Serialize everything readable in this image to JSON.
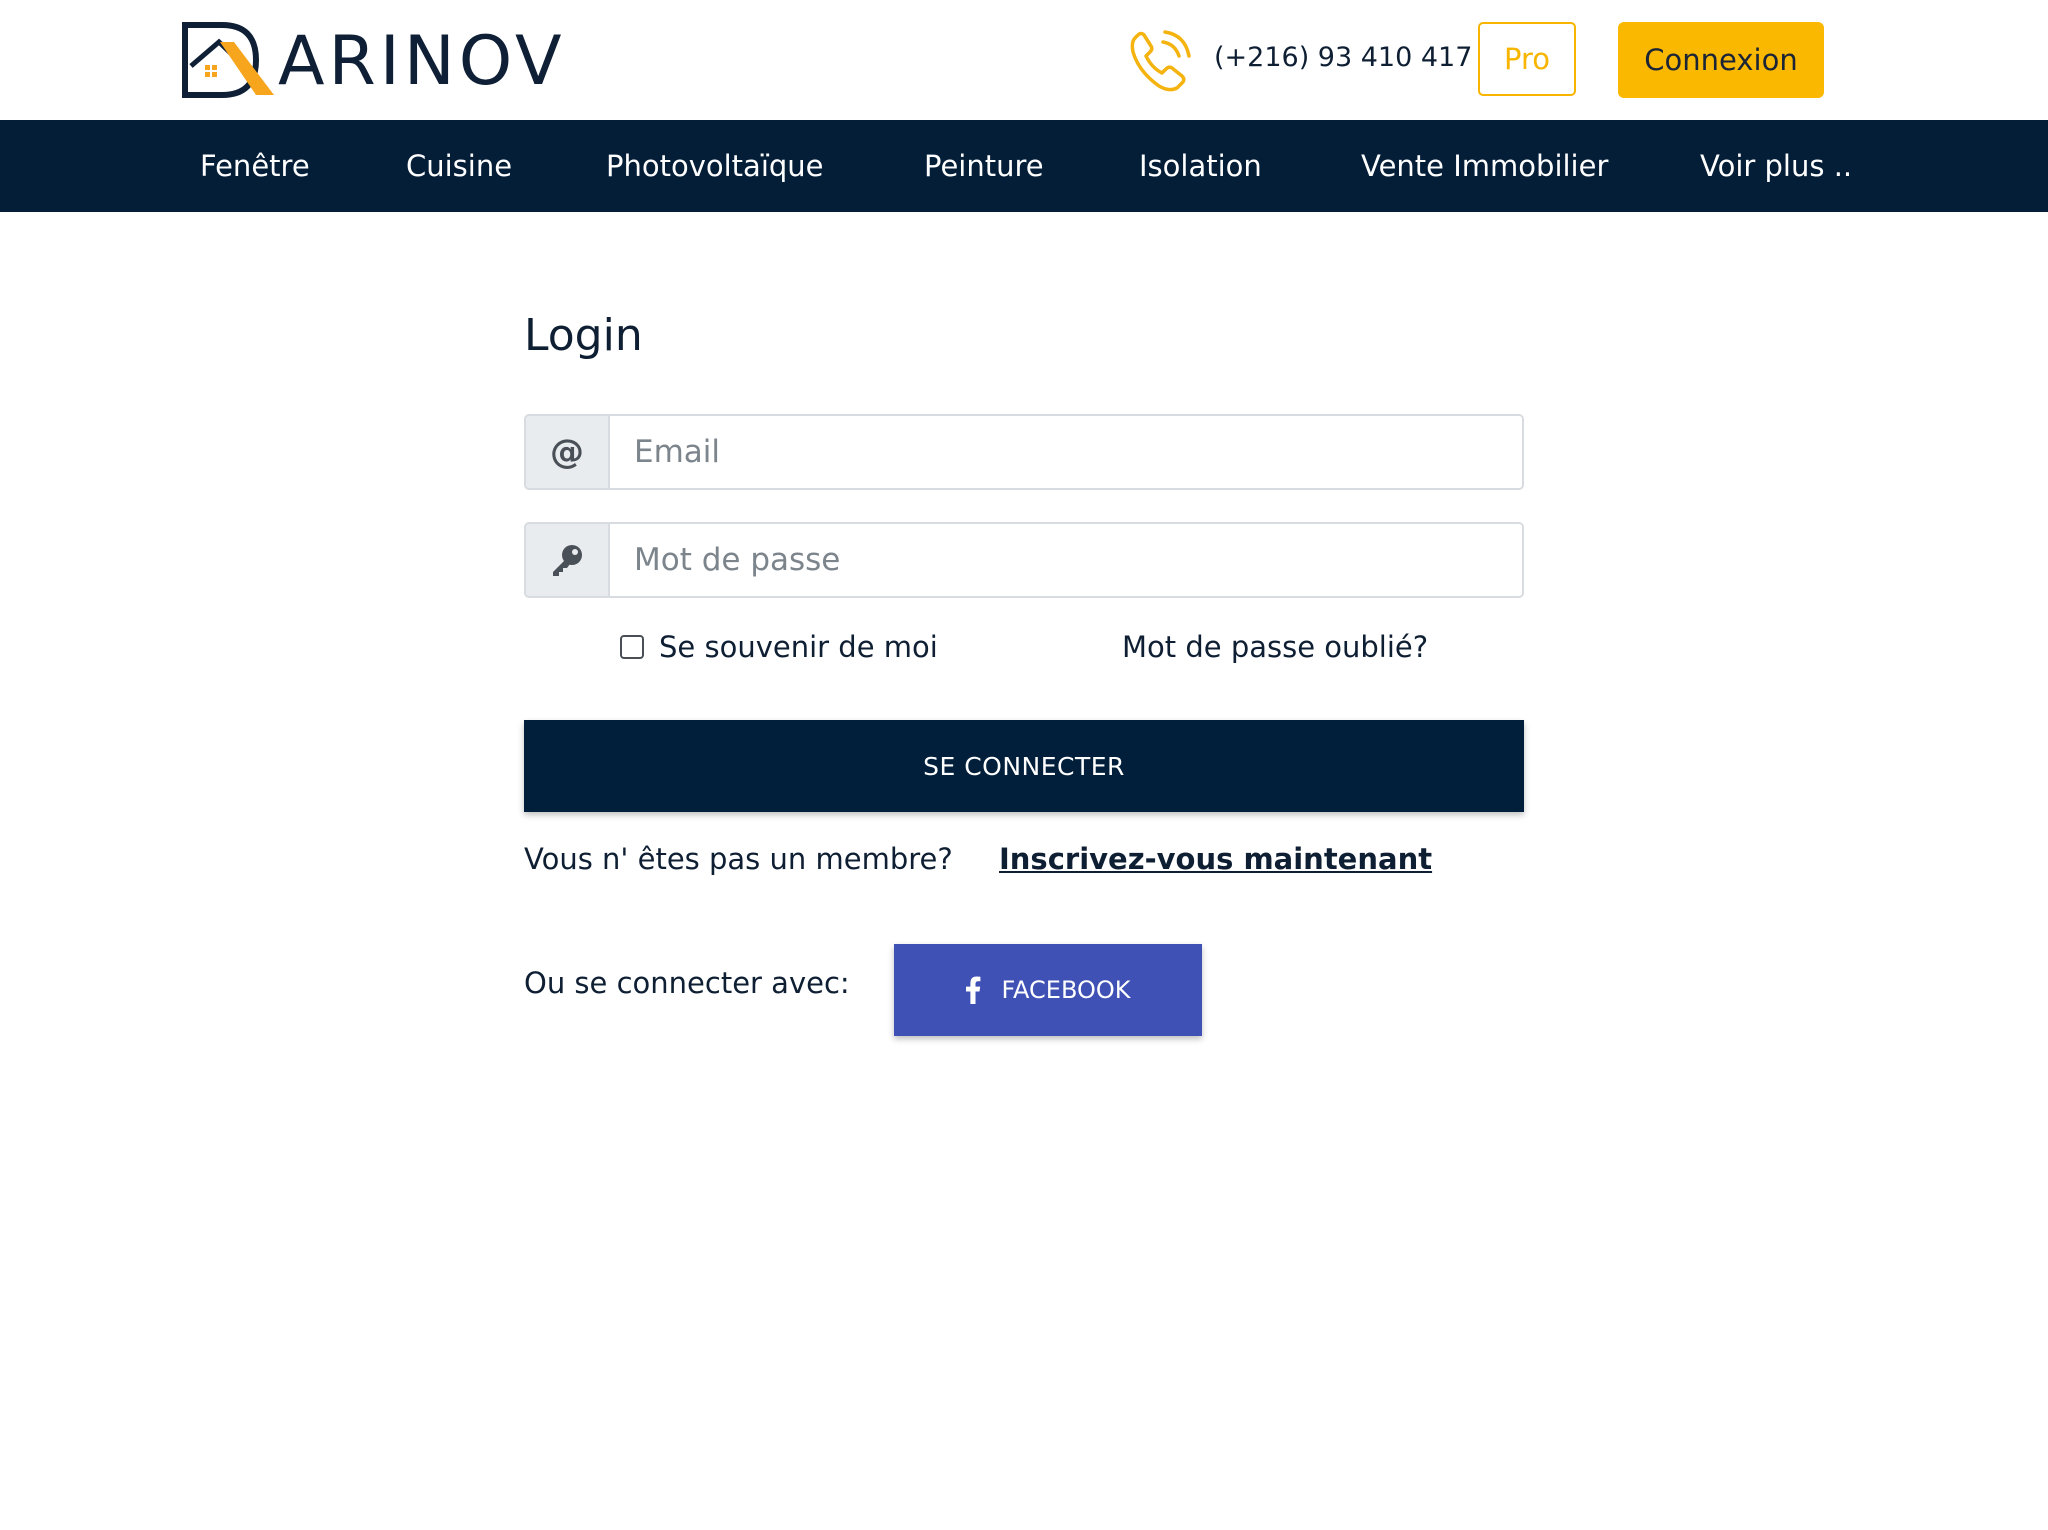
{
  "header": {
    "logo_text": "ARINOV",
    "phone": "(+216) 93 410 417",
    "pro_label": "Pro",
    "connexion_label": "Connexion",
    "icons": [
      "logo-icon",
      "phone-icon"
    ]
  },
  "nav": {
    "items": [
      {
        "label": "Fenêtre"
      },
      {
        "label": "Cuisine"
      },
      {
        "label": "Photovoltaïque"
      },
      {
        "label": "Peinture"
      },
      {
        "label": "Isolation"
      },
      {
        "label": "Vente Immobilier"
      },
      {
        "label": "Voir plus .."
      }
    ]
  },
  "login": {
    "title": "Login",
    "email_placeholder": "Email",
    "email_value": "",
    "email_icon": "at-icon",
    "password_placeholder": "Mot de passe",
    "password_value": "",
    "password_icon": "key-icon",
    "remember_label": "Se souvenir de moi",
    "remember_checked": false,
    "forgot_label": "Mot de passe oublié?",
    "submit_label": "SE CONNECTER",
    "not_member_text": "Vous n' êtes pas un membre?",
    "signup_label": "Inscrivez-vous maintenant",
    "social_label": "Ou se connecter avec:",
    "facebook_label": "FACEBOOK",
    "facebook_icon": "facebook-icon"
  },
  "colors": {
    "accent": "#fbb800",
    "navy": "#041e38",
    "facebook": "#3f51b5",
    "text": "#0f1f33"
  }
}
